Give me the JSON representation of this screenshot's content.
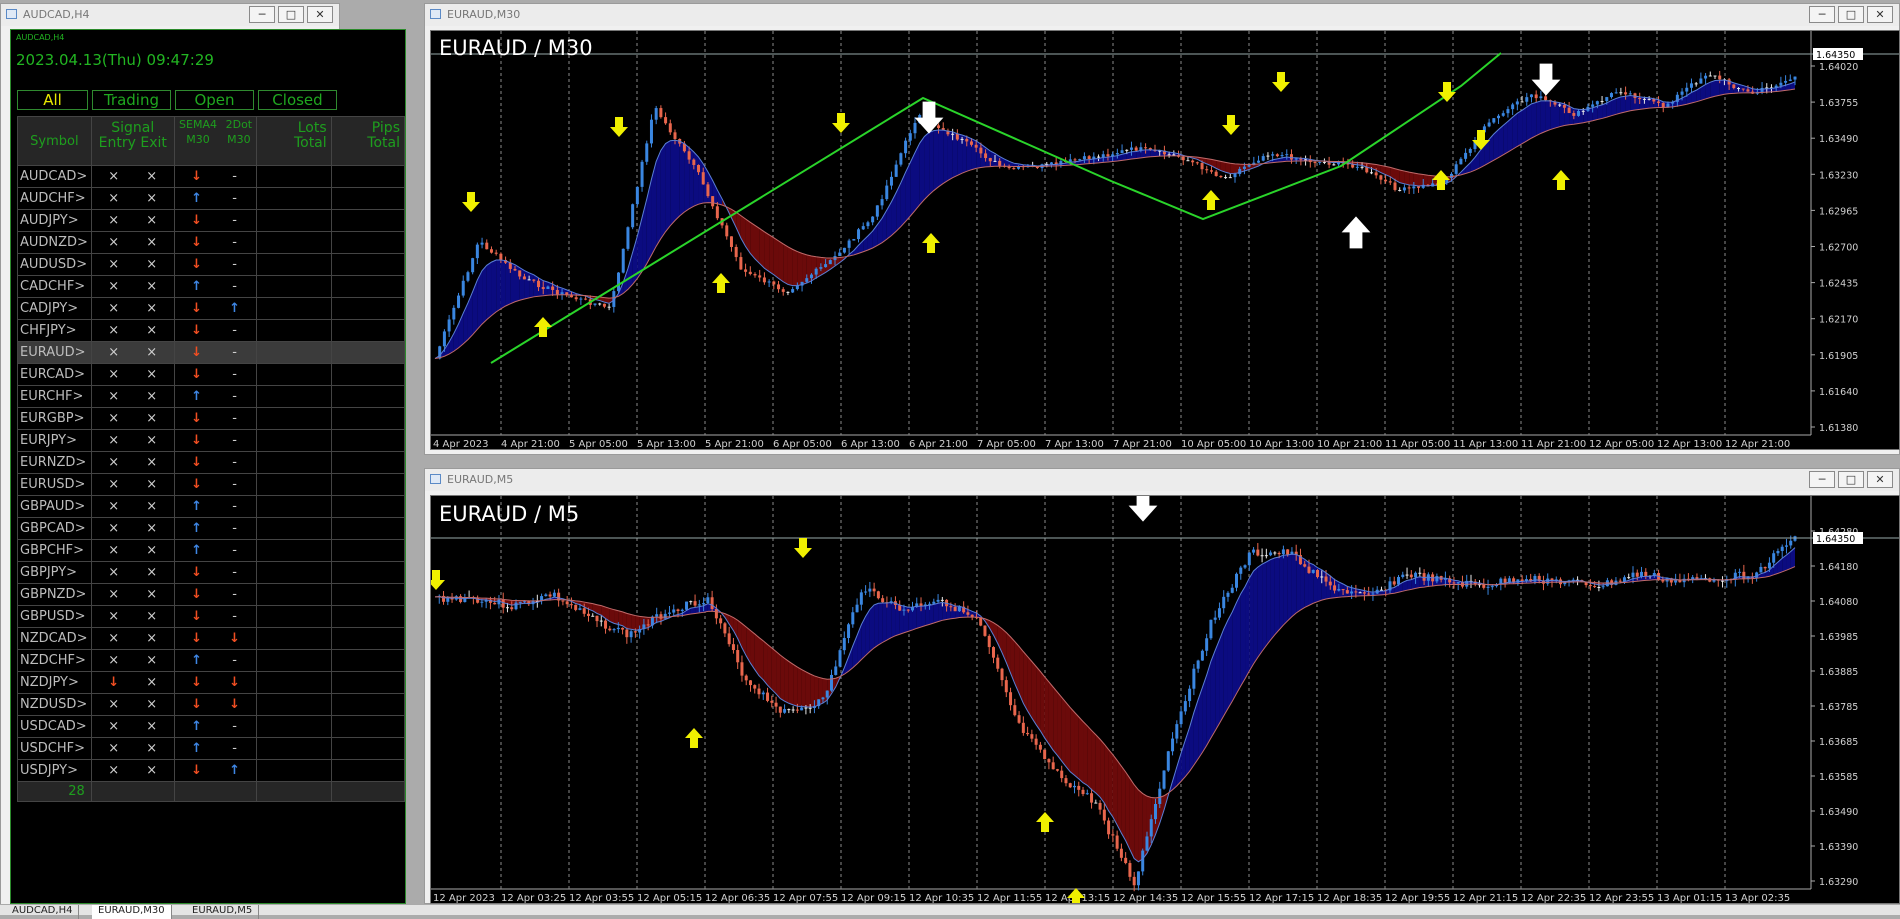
{
  "left_window": {
    "title": "AUDCAD,H4",
    "panel_label": "AUDCAD,H4",
    "datetime": "2023.04.13(Thu) 09:47:29",
    "filters": [
      "All",
      "Trading",
      "Open",
      "Closed"
    ],
    "headers": {
      "symbol": "Symbol",
      "signal": "Signal",
      "entry": "Entry",
      "exit": "Exit",
      "sema": "SEMA4",
      "sema_tf": "M30",
      "dot": "2Dot",
      "dot_tf": "M30",
      "lots": "Lots",
      "lots_sub": "Total",
      "pips": "Pips",
      "pips_sub": "Total"
    },
    "rows": [
      {
        "s": "AUDCAD>",
        "en": "×",
        "ex": "×",
        "sema": "down",
        "dot": "-"
      },
      {
        "s": "AUDCHF>",
        "en": "×",
        "ex": "×",
        "sema": "up",
        "dot": "-"
      },
      {
        "s": "AUDJPY>",
        "en": "×",
        "ex": "×",
        "sema": "down",
        "dot": "-"
      },
      {
        "s": "AUDNZD>",
        "en": "×",
        "ex": "×",
        "sema": "down",
        "dot": "-"
      },
      {
        "s": "AUDUSD>",
        "en": "×",
        "ex": "×",
        "sema": "down",
        "dot": "-"
      },
      {
        "s": "CADCHF>",
        "en": "×",
        "ex": "×",
        "sema": "up",
        "dot": "-"
      },
      {
        "s": "CADJPY>",
        "en": "×",
        "ex": "×",
        "sema": "down",
        "dot": "up"
      },
      {
        "s": "CHFJPY>",
        "en": "×",
        "ex": "×",
        "sema": "down",
        "dot": "-"
      },
      {
        "s": "EURAUD>",
        "en": "×",
        "ex": "×",
        "sema": "down",
        "dot": "-",
        "selected": true
      },
      {
        "s": "EURCAD>",
        "en": "×",
        "ex": "×",
        "sema": "down",
        "dot": "-"
      },
      {
        "s": "EURCHF>",
        "en": "×",
        "ex": "×",
        "sema": "up",
        "dot": "-"
      },
      {
        "s": "EURGBP>",
        "en": "×",
        "ex": "×",
        "sema": "down",
        "dot": "-"
      },
      {
        "s": "EURJPY>",
        "en": "×",
        "ex": "×",
        "sema": "down",
        "dot": "-"
      },
      {
        "s": "EURNZD>",
        "en": "×",
        "ex": "×",
        "sema": "down",
        "dot": "-"
      },
      {
        "s": "EURUSD>",
        "en": "×",
        "ex": "×",
        "sema": "down",
        "dot": "-"
      },
      {
        "s": "GBPAUD>",
        "en": "×",
        "ex": "×",
        "sema": "up",
        "dot": "-"
      },
      {
        "s": "GBPCAD>",
        "en": "×",
        "ex": "×",
        "sema": "up",
        "dot": "-"
      },
      {
        "s": "GBPCHF>",
        "en": "×",
        "ex": "×",
        "sema": "up",
        "dot": "-"
      },
      {
        "s": "GBPJPY>",
        "en": "×",
        "ex": "×",
        "sema": "down",
        "dot": "-"
      },
      {
        "s": "GBPNZD>",
        "en": "×",
        "ex": "×",
        "sema": "down",
        "dot": "-"
      },
      {
        "s": "GBPUSD>",
        "en": "×",
        "ex": "×",
        "sema": "down",
        "dot": "-"
      },
      {
        "s": "NZDCAD>",
        "en": "×",
        "ex": "×",
        "sema": "down",
        "dot": "down"
      },
      {
        "s": "NZDCHF>",
        "en": "×",
        "ex": "×",
        "sema": "up",
        "dot": "-"
      },
      {
        "s": "NZDJPY>",
        "en": "down",
        "ex": "×",
        "sema": "down",
        "dot": "down"
      },
      {
        "s": "NZDUSD>",
        "en": "×",
        "ex": "×",
        "sema": "down",
        "dot": "down"
      },
      {
        "s": "USDCAD>",
        "en": "×",
        "ex": "×",
        "sema": "up",
        "dot": "-"
      },
      {
        "s": "USDCHF>",
        "en": "×",
        "ex": "×",
        "sema": "up",
        "dot": "-"
      },
      {
        "s": "USDJPY>",
        "en": "×",
        "ex": "×",
        "sema": "down",
        "dot": "up"
      }
    ],
    "total_count": "28"
  },
  "top_window": {
    "title": "EURAUD,M30",
    "chart_label": "EURAUD / M30",
    "current_price": "1.64350",
    "price_ticks": [
      "1.64020",
      "1.63755",
      "1.63490",
      "1.63230",
      "1.62965",
      "1.62700",
      "1.62435",
      "1.62170",
      "1.61905",
      "1.61640",
      "1.61380"
    ],
    "time_ticks": [
      "4 Apr 2023",
      "4 Apr 21:00",
      "5 Apr 05:00",
      "5 Apr 13:00",
      "5 Apr 21:00",
      "6 Apr 05:00",
      "6 Apr 13:00",
      "6 Apr 21:00",
      "7 Apr 05:00",
      "7 Apr 13:00",
      "7 Apr 21:00",
      "10 Apr 05:00",
      "10 Apr 13:00",
      "10 Apr 21:00",
      "11 Apr 05:00",
      "11 Apr 13:00",
      "11 Apr 21:00",
      "12 Apr 05:00",
      "12 Apr 13:00",
      "12 Apr 21:00"
    ]
  },
  "bottom_window": {
    "title": "EURAUD,M5",
    "chart_label": "EURAUD / M5",
    "current_price": "1.64350",
    "price_ticks": [
      "1.64280",
      "1.64180",
      "1.64080",
      "1.63985",
      "1.63885",
      "1.63785",
      "1.63685",
      "1.63585",
      "1.63490",
      "1.63390",
      "1.63290"
    ],
    "time_ticks": [
      "12 Apr 2023",
      "12 Apr 03:25",
      "12 Apr 03:55",
      "12 Apr 05:15",
      "12 Apr 06:35",
      "12 Apr 07:55",
      "12 Apr 09:15",
      "12 Apr 10:35",
      "12 Apr 11:55",
      "12 Apr 13:15",
      "12 Apr 14:35",
      "12 Apr 15:55",
      "12 Apr 17:15",
      "12 Apr 18:35",
      "12 Apr 19:55",
      "12 Apr 21:15",
      "12 Apr 22:35",
      "12 Apr 23:55",
      "13 Apr 01:15",
      "13 Apr 02:35"
    ]
  },
  "bottom_tabs": [
    "AUDCAD,H4",
    "EURAUD,M30",
    "EURAUD,M5"
  ],
  "colors": {
    "bull": "#3a86e0",
    "bear": "#e8664d",
    "neutral": "#e8e8e8",
    "cloud_bull": "#0b0b80",
    "cloud_bear": "#6b0a0a",
    "trend": "#2ad42a",
    "signal_yellow": "#f0f000",
    "signal_white": "#ffffff"
  }
}
